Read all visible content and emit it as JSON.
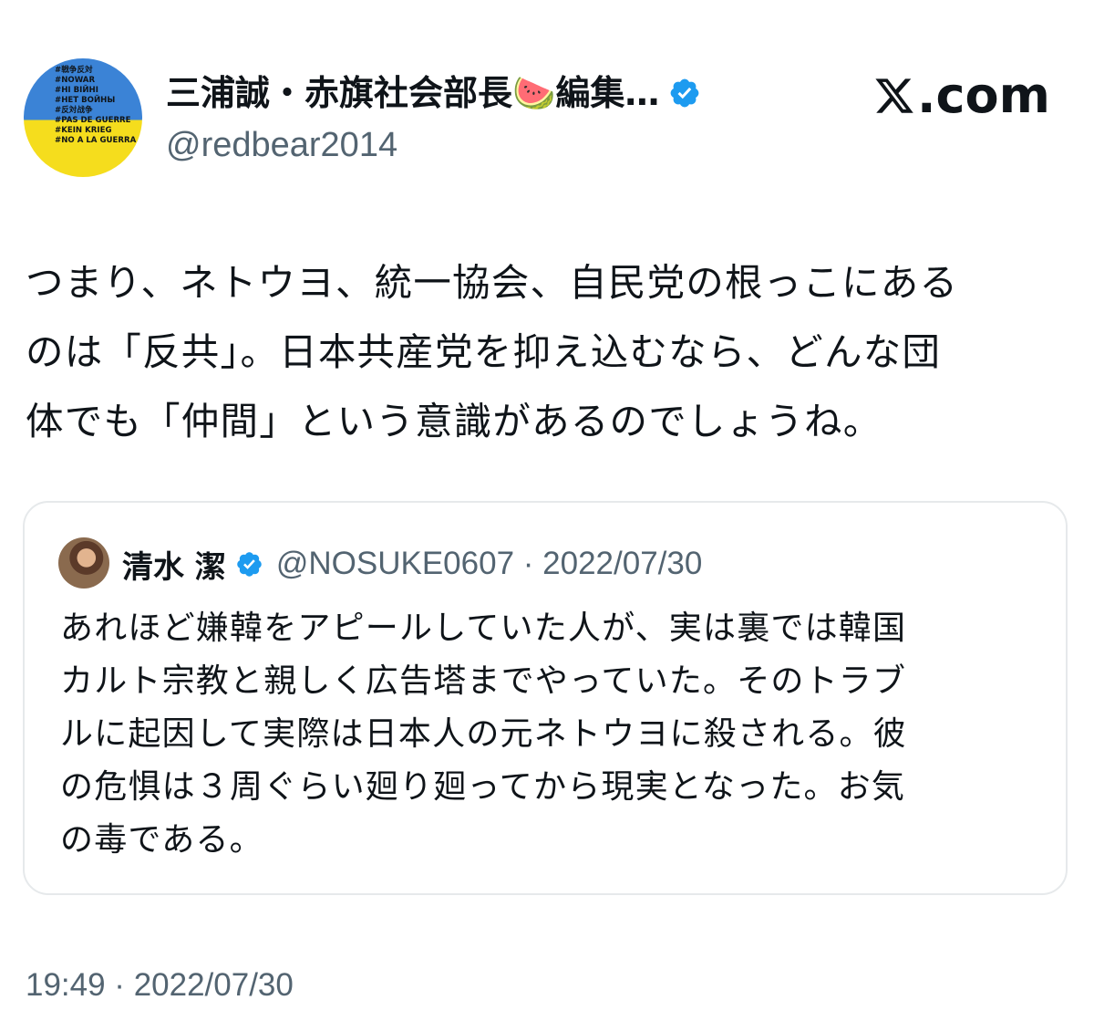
{
  "author": {
    "display_name": "三浦誠・赤旗社会部長🍉編集…",
    "handle": "@redbear2014",
    "verified": true,
    "avatar_lines": [
      "#戦争反対",
      "#NOWAR",
      "#НІ ВІЙНІ",
      "#НЕТ ВОЙНЫ",
      "#反対战争",
      "#PAS DE GUERRE",
      "#KEIN KRIEG",
      "#NO A LA GUERRA"
    ],
    "avatar_colors": {
      "top": "#3b83d6",
      "bottom": "#f5dd1d"
    }
  },
  "brand": {
    "text": ".com",
    "icon": "x-logo-icon"
  },
  "tweet": {
    "lines": [
      "つまり、ネトウヨ、統一協会、自民党の根っこにある",
      "のは「反共」。日本共産党を抑え込むなら、どんな団",
      "体でも「仲間」という意識があるのでしょうね。"
    ],
    "timestamp": "19:49 · 2022/07/30"
  },
  "quoted_tweet": {
    "display_name": "清水 潔",
    "verified": true,
    "meta": "@NOSUKE0607 · 2022/07/30",
    "lines": [
      "あれほど嫌韓をアピールしていた人が、実は裏では韓国",
      "カルト宗教と親しく広告塔までやっていた。そのトラブ",
      "ルに起因して実際は日本人の元ネトウヨに殺される。彼",
      "の危惧は３周ぐらい廻り廻ってから現実となった。お気",
      "の毒である。"
    ]
  },
  "colors": {
    "text": "#0f1419",
    "secondary": "#536471",
    "verified_blue": "#1d9bf0",
    "card_border": "#e6e9eb"
  }
}
